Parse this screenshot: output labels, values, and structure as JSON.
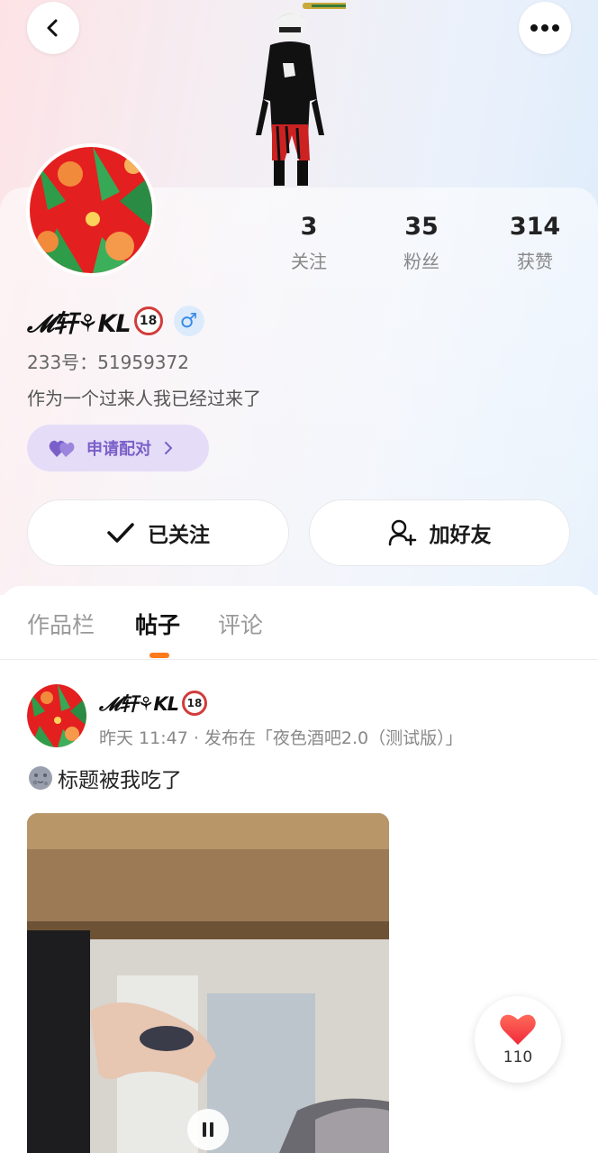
{
  "header": {
    "back_icon": "chevron-left-icon",
    "more_icon": "more-horizontal-icon"
  },
  "profile": {
    "name": "𝓜轩⚘KL",
    "badge": "18",
    "gender_symbol": "♂",
    "uid": "233号：51959372",
    "bio": "作为一个过来人我已经过来了",
    "stats": [
      {
        "num": "3",
        "label": "关注"
      },
      {
        "num": "35",
        "label": "粉丝"
      },
      {
        "num": "314",
        "label": "获赞"
      }
    ],
    "pair_button": "申请配对",
    "follow_button": "已关注",
    "add_friend_button": "加好友"
  },
  "tabs": [
    {
      "label": "作品栏",
      "active": false
    },
    {
      "label": "帖子",
      "active": true
    },
    {
      "label": "评论",
      "active": false
    }
  ],
  "post": {
    "author": "𝓜轩⚘KL",
    "badge": "18",
    "meta": "昨天 11:47 · 发布在「夜色酒吧2.0（测试版）」",
    "title_emoji": "moon-face-icon",
    "title": "标题被我吃了"
  },
  "like": {
    "count": "110"
  },
  "colors": {
    "accent_orange": "#ff7a1a",
    "pair_purple": "#7a5fc9",
    "like_red": "#ff3b3b"
  }
}
